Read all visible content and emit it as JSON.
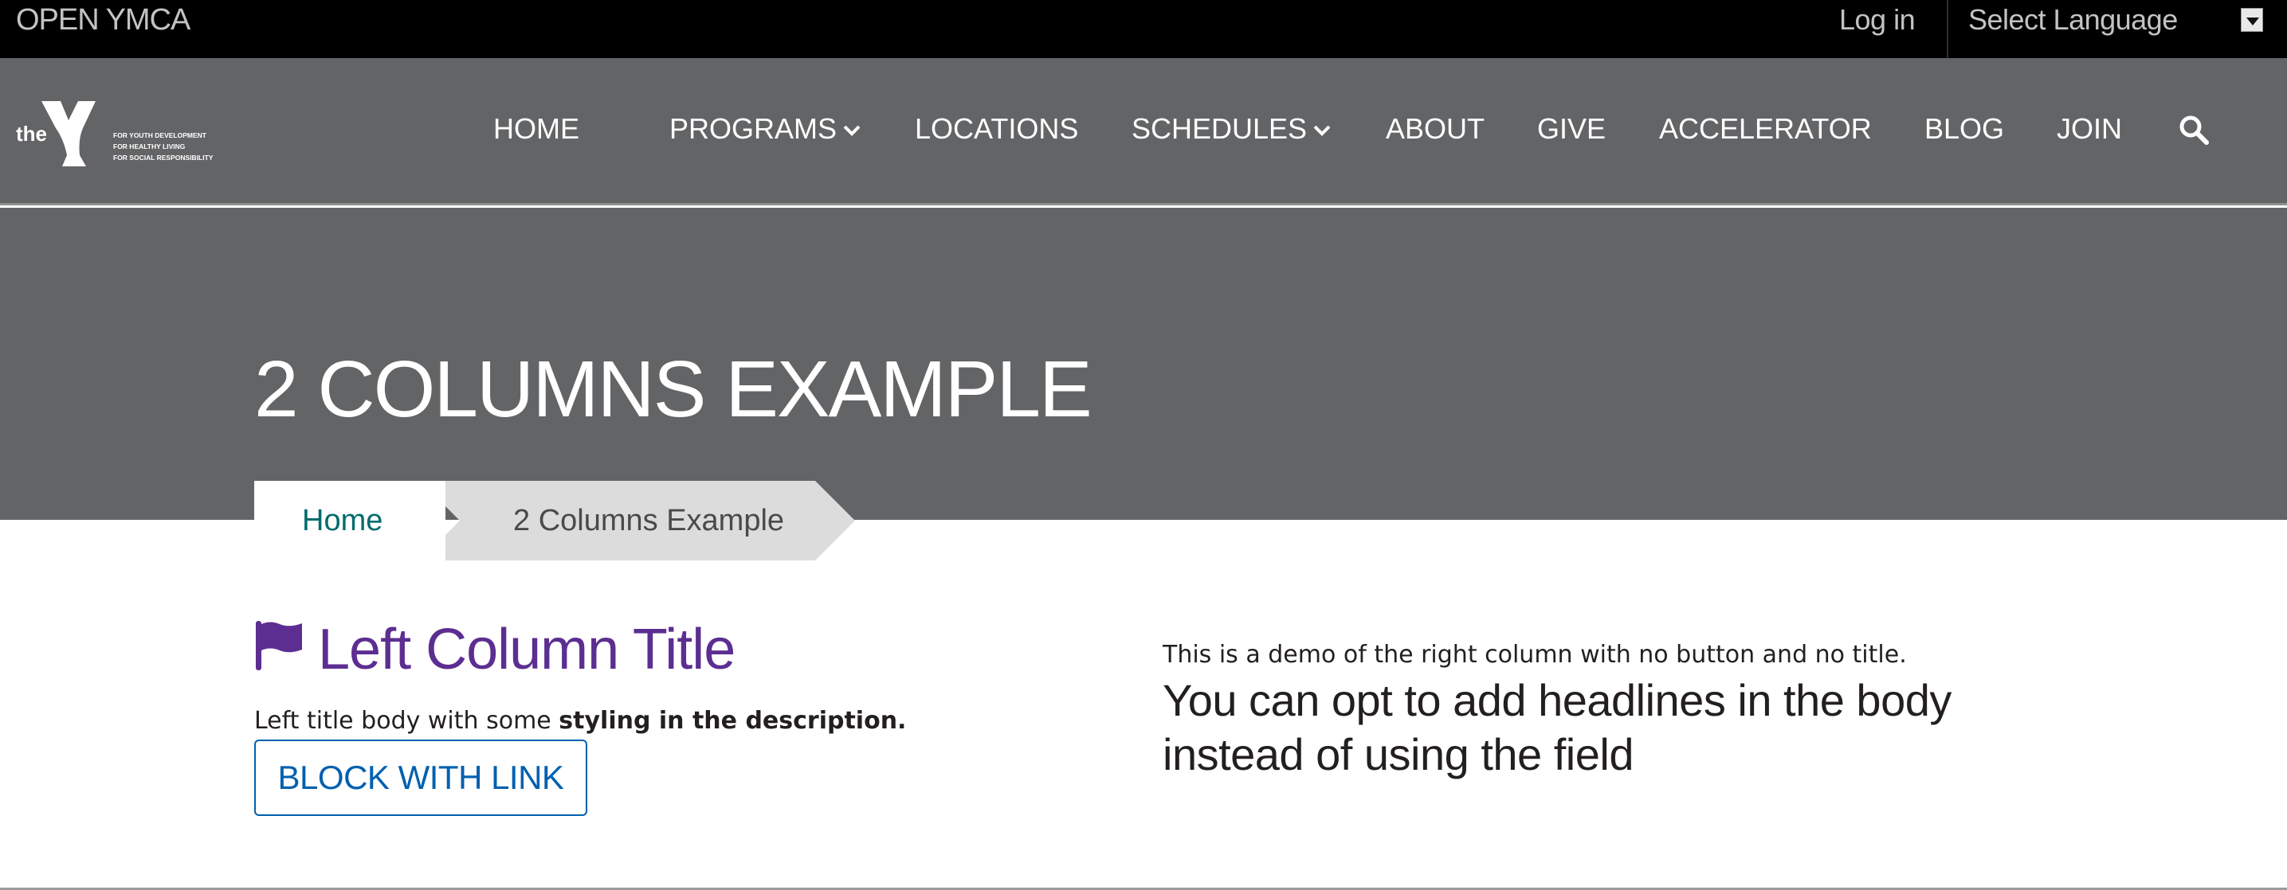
{
  "topbar": {
    "site_name": "OPEN YMCA",
    "login_label": "Log in",
    "language_select": "Select Language"
  },
  "logo": {
    "word": "the",
    "tagline_1": "FOR YOUTH DEVELOPMENT",
    "tagline_2": "FOR HEALTHY LIVING",
    "tagline_3": "FOR SOCIAL RESPONSIBILITY",
    "y_mark": "YMCA"
  },
  "nav": {
    "items": [
      {
        "label": "HOME",
        "dropdown": false
      },
      {
        "label": "PROGRAMS",
        "dropdown": true
      },
      {
        "label": "LOCATIONS",
        "dropdown": false
      },
      {
        "label": "SCHEDULES",
        "dropdown": true
      },
      {
        "label": "ABOUT",
        "dropdown": false
      },
      {
        "label": "GIVE",
        "dropdown": false
      },
      {
        "label": "ACCELERATOR",
        "dropdown": false
      },
      {
        "label": "BLOG",
        "dropdown": false
      },
      {
        "label": "JOIN",
        "dropdown": false
      }
    ],
    "search_icon": "search-icon"
  },
  "banner": {
    "title": "2 COLUMNS EXAMPLE"
  },
  "breadcrumb": {
    "home": "Home",
    "current": "2 Columns Example"
  },
  "left_column": {
    "icon": "flag-icon",
    "title": "Left Column Title",
    "body_plain": "Left title body with some ",
    "body_bold": "styling in the description.",
    "button_label": "BLOCK WITH LINK"
  },
  "right_column": {
    "intro": "This is a demo of the right column with no button and no title.",
    "headline": "You can opt to add headlines in the body instead of using the field"
  },
  "colors": {
    "topbar_bg": "#000000",
    "nav_bg": "#636466",
    "title_purple": "#5c2e91",
    "link_teal": "#006b6b",
    "button_blue": "#0060af",
    "breadcrumb_current_bg": "#dcdcdc"
  }
}
